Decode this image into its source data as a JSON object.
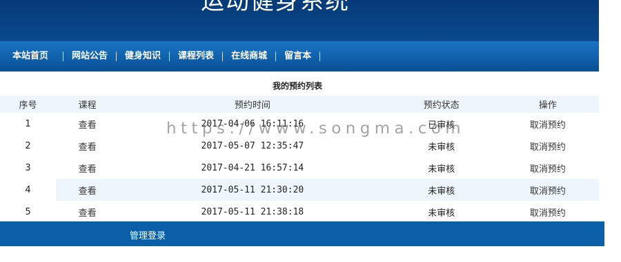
{
  "header": {
    "site_title": "运动健身系统"
  },
  "nav": {
    "items": [
      "本站首页",
      "网站公告",
      "健身知识",
      "课程列表",
      "在线商城",
      "留言本"
    ]
  },
  "content": {
    "title": "我的预约列表",
    "columns": [
      "序号",
      "课程",
      "预约时间",
      "预约状态",
      "操作"
    ],
    "rows": [
      {
        "no": "1",
        "course_link": "查看",
        "time": "2017-04-06 16:11:16",
        "status": "已审核",
        "action": "取消预约"
      },
      {
        "no": "2",
        "course_link": "查看",
        "time": "2017-05-07 12:35:47",
        "status": "未审核",
        "action": "取消预约"
      },
      {
        "no": "3",
        "course_link": "查看",
        "time": "2017-04-21 16:57:14",
        "status": "未审核",
        "action": "取消预约"
      },
      {
        "no": "4",
        "course_link": "查看",
        "time": "2017-05-11 21:30:20",
        "status": "未审核",
        "action": "取消预约"
      },
      {
        "no": "5",
        "course_link": "查看",
        "time": "2017-05-11 21:38:18",
        "status": "未审核",
        "action": "取消预约"
      }
    ]
  },
  "footer": {
    "admin_login": "管理登录"
  },
  "watermark": "https://www.songma.com"
}
